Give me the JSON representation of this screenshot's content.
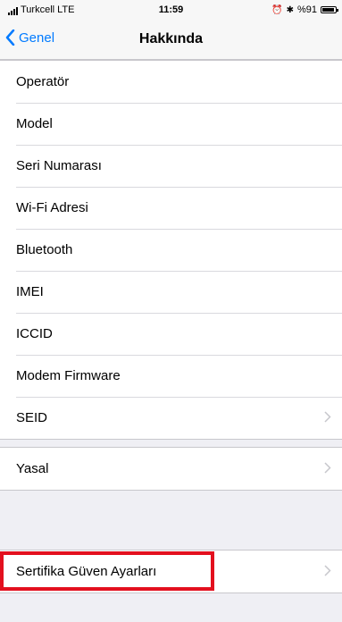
{
  "status_bar": {
    "carrier": "Turkcell",
    "network": "LTE",
    "time": "11:59",
    "battery_label": "%91",
    "battery_level": 0.91
  },
  "nav": {
    "back_label": "Genel",
    "title": "Hakkında"
  },
  "group1": {
    "items": [
      {
        "label": "Operatör"
      },
      {
        "label": "Model"
      },
      {
        "label": "Seri Numarası"
      },
      {
        "label": "Wi-Fi Adresi"
      },
      {
        "label": "Bluetooth"
      },
      {
        "label": "IMEI"
      },
      {
        "label": "ICCID"
      },
      {
        "label": "Modem Firmware"
      },
      {
        "label": "SEID"
      }
    ]
  },
  "group2": {
    "items": [
      {
        "label": "Yasal"
      }
    ]
  },
  "group3": {
    "items": [
      {
        "label": "Sertifika Güven Ayarları"
      }
    ]
  },
  "colors": {
    "accent": "#007aff",
    "highlight": "#e3101e",
    "background": "#efeff4"
  }
}
